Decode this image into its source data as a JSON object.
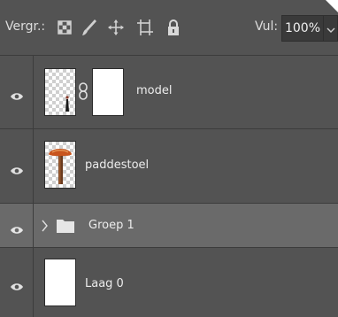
{
  "toolbar": {
    "lock_label": "Vergr.:",
    "lock_icons": [
      "lock-transparent-pixels-icon",
      "lock-image-pixels-icon",
      "lock-position-icon",
      "lock-artboard-icon",
      "lock-all-icon"
    ],
    "fill_label": "Vul:",
    "fill_value": "100%"
  },
  "layers": [
    {
      "name": "model",
      "type": "layer-with-mask",
      "visible": true,
      "selected": false
    },
    {
      "name": "paddestoel",
      "type": "layer",
      "visible": true,
      "selected": false
    },
    {
      "name": "Groep 1",
      "type": "group",
      "visible": true,
      "selected": true,
      "collapsed": true
    },
    {
      "name": "Laag 0",
      "type": "layer",
      "visible": true,
      "selected": false
    }
  ],
  "colors": {
    "panel_bg": "#535353",
    "selected_row": "#6a6a6a",
    "divider": "#3c3c3c",
    "text": "#ececec",
    "mushroom_cap": "#c8551e"
  }
}
